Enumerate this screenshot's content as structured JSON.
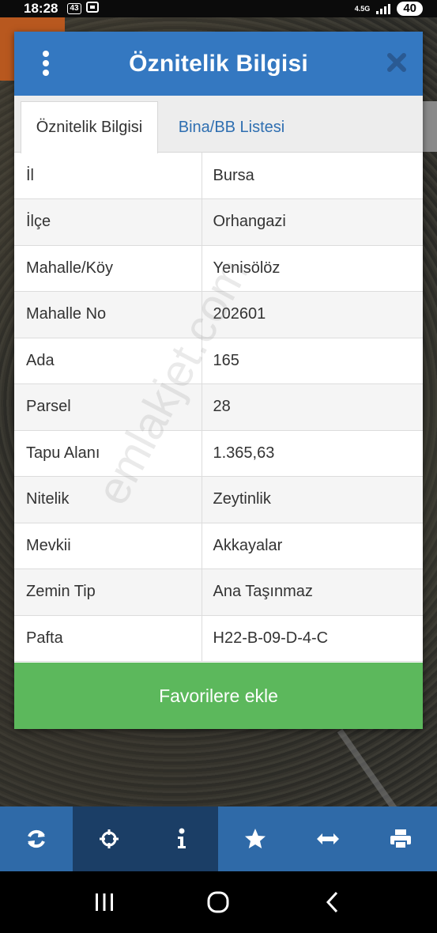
{
  "status_bar": {
    "time": "18:28",
    "mini_badge": "43",
    "network": "4.5G",
    "battery": "40"
  },
  "dialog": {
    "title": "Öznitelik Bilgisi",
    "tabs": [
      {
        "label": "Öznitelik Bilgisi",
        "active": true
      },
      {
        "label": "Bina/BB Listesi",
        "active": false
      }
    ],
    "rows": [
      {
        "key": "İl",
        "value": "Bursa"
      },
      {
        "key": "İlçe",
        "value": "Orhangazi"
      },
      {
        "key": "Mahalle/Köy",
        "value": "Yenisölöz"
      },
      {
        "key": "Mahalle No",
        "value": "202601"
      },
      {
        "key": "Ada",
        "value": "165"
      },
      {
        "key": "Parsel",
        "value": "28"
      },
      {
        "key": "Tapu Alanı",
        "value": "1.365,63"
      },
      {
        "key": "Nitelik",
        "value": "Zeytinlik"
      },
      {
        "key": "Mevkii",
        "value": "Akkayalar"
      },
      {
        "key": "Zemin Tip",
        "value": "Ana Taşınmaz"
      },
      {
        "key": "Pafta",
        "value": "H22-B-09-D-4-C"
      }
    ],
    "favorite_button": "Favorilere ekle"
  },
  "watermark": "emlakjet.com",
  "toolbar": {
    "items": [
      "refresh-icon",
      "crosshair-icon",
      "info-icon",
      "star-icon",
      "measure-icon",
      "print-icon"
    ]
  },
  "colors": {
    "header": "#3478c1",
    "button": "#5cb85c",
    "toolbar": "#2f6aa8",
    "toolbar_active": "#1b3e66"
  }
}
